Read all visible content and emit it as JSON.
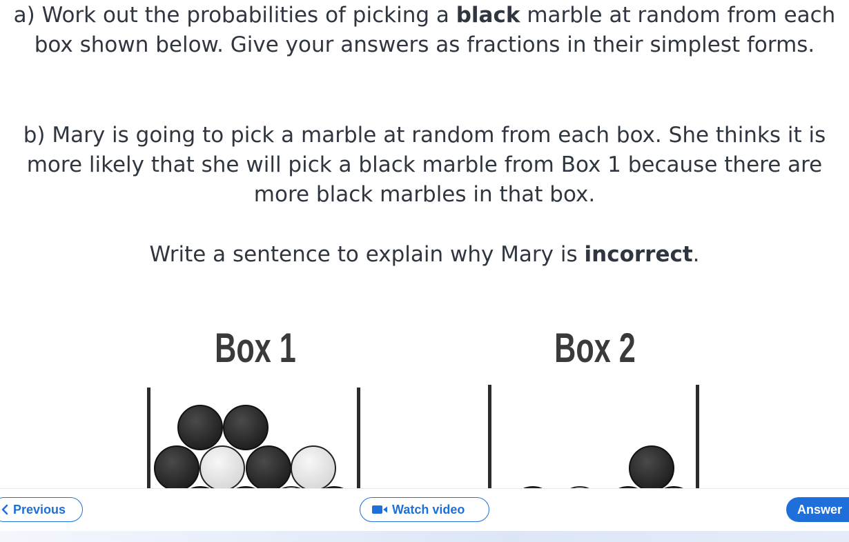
{
  "question": {
    "part_a": {
      "before": "a) Work out the probabilities of picking a ",
      "bold": "black",
      "after": " marble at random from each box shown below. Give your answers as fractions in their simplest forms."
    },
    "part_b": "b) Mary is going to pick a marble at random from each box. She thinks it is more likely that she will pick a black marble from Box 1 because there are more black marbles in that box.",
    "instruction": {
      "before": "Write a sentence to explain why Mary is ",
      "bold": "incorrect",
      "after": "."
    }
  },
  "diagram": {
    "box1_title": "Box 1",
    "box2_title": "Box 2",
    "colors": {
      "black_marble": "#2b2b2b",
      "white_marble": "#e6e6e6",
      "wall": "#2b2b2b"
    }
  },
  "footer": {
    "previous_label": "Previous",
    "watch_video_label": "Watch video",
    "answer_label": "Answer",
    "icons": {
      "previous": "chevron-left-icon",
      "video": "video-camera-icon"
    },
    "colors": {
      "accent": "#1e6fd9"
    }
  }
}
